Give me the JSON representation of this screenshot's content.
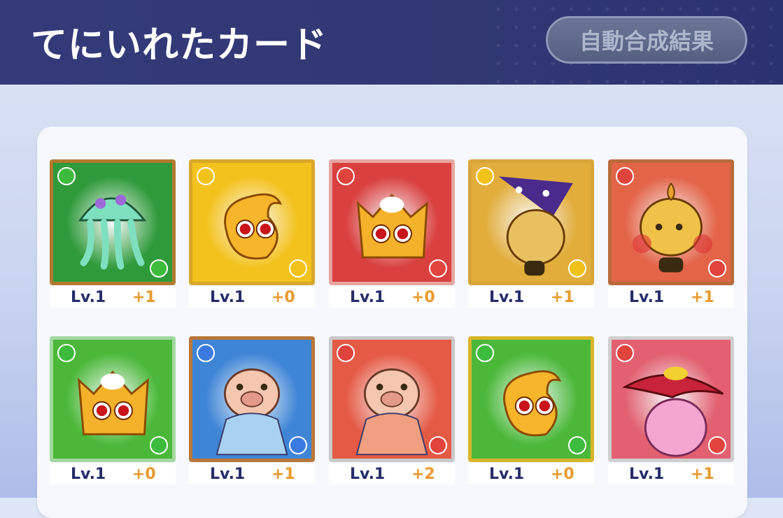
{
  "header": {
    "title": "てにいれたカード",
    "merge_button": "自動合成結果"
  },
  "cards": [
    {
      "name": "jellyfish-card",
      "level": "Lv.1",
      "plus": "+1",
      "bg": "#2f9a3a",
      "frame": "#b37a2f",
      "attr": "green",
      "character": "jellyfish"
    },
    {
      "name": "yellow-puyo-card",
      "level": "Lv.1",
      "plus": "+0",
      "bg": "#f4c21d",
      "frame": "#d7a82a",
      "attr": "yellow",
      "character": "yellow-puyo"
    },
    {
      "name": "red-crown-card",
      "level": "Lv.1",
      "plus": "+0",
      "bg": "#d9403e",
      "frame": "#e7a5a0",
      "attr": "red",
      "character": "red-crown-puyo"
    },
    {
      "name": "onion-witch-card",
      "level": "Lv.1",
      "plus": "+1",
      "bg": "#e2ad3a",
      "frame": "#d8a53a",
      "attr": "yellow",
      "character": "onion-witch"
    },
    {
      "name": "onion-bee-card",
      "level": "Lv.1",
      "plus": "+1",
      "bg": "#e46448",
      "frame": "#b96b3a",
      "attr": "red",
      "character": "onion-bee"
    },
    {
      "name": "green-crown-card",
      "level": "Lv.1",
      "plus": "+0",
      "bg": "#4cb83a",
      "frame": "#a3d8a0",
      "attr": "green",
      "character": "green-crown-puyo"
    },
    {
      "name": "blue-pig-card",
      "level": "Lv.1",
      "plus": "+1",
      "bg": "#3f85d6",
      "frame": "#b9773a",
      "attr": "blue",
      "character": "pig-blue"
    },
    {
      "name": "red-pig-card",
      "level": "Lv.1",
      "plus": "+2",
      "bg": "#e55a45",
      "frame": "#c9c9c9",
      "attr": "red",
      "character": "pig-red"
    },
    {
      "name": "green-puyo-card",
      "level": "Lv.1",
      "plus": "+0",
      "bg": "#4cb83a",
      "frame": "#d8b52a",
      "attr": "green",
      "character": "green-puyo"
    },
    {
      "name": "pink-hat-card",
      "level": "Lv.1",
      "plus": "+1",
      "bg": "#e26070",
      "frame": "#cfcfcf",
      "attr": "red",
      "character": "pink-hat"
    }
  ]
}
